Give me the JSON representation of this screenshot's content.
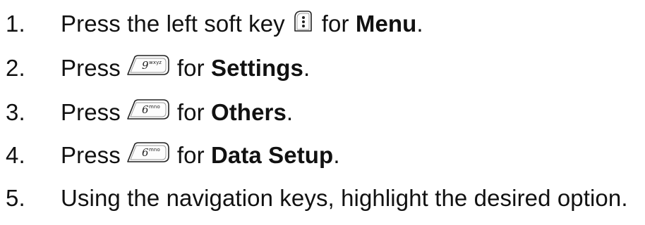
{
  "steps": [
    {
      "number": "1.",
      "pre": "Press the left soft key",
      "key": "left-soft-key-icon",
      "mid": "for",
      "bold": "Menu",
      "post": "."
    },
    {
      "number": "2.",
      "pre": "Press",
      "key": "9-wxyz-key-icon",
      "key_main": "9",
      "key_sub": "wxyz",
      "mid": "for",
      "bold": "Settings",
      "post": "."
    },
    {
      "number": "3.",
      "pre": "Press",
      "key": "6-mno-key-icon",
      "key_main": "6",
      "key_sub": "mno",
      "mid": "for",
      "bold": "Others",
      "post": "."
    },
    {
      "number": "4.",
      "pre": "Press",
      "key": "6-mno-key-icon",
      "key_main": "6",
      "key_sub": "mno",
      "mid": "for",
      "bold": "Data Setup",
      "post": "."
    },
    {
      "number": "5.",
      "text": "Using the navigation keys, highlight the desired option."
    }
  ]
}
